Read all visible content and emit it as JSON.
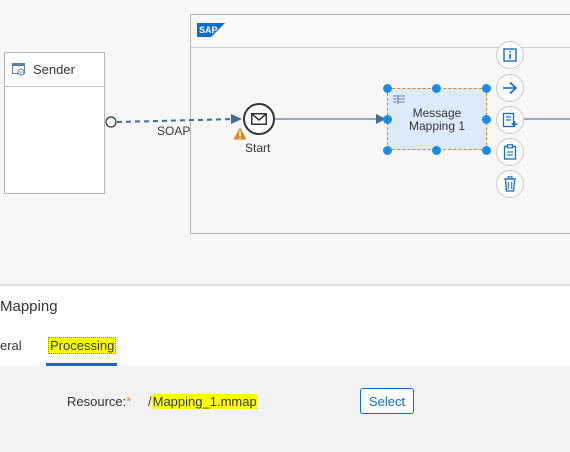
{
  "diagram": {
    "sender": {
      "label": "Sender"
    },
    "integration_process": {
      "logo": "SAP"
    },
    "connection": {
      "adapter_label": "SOAP"
    },
    "start_event": {
      "label": "Start",
      "icon": "envelope-icon",
      "warning_icon": "warning-icon"
    },
    "mapping_step": {
      "line1": "Message",
      "line2": "Mapping 1"
    },
    "context_buttons": [
      "info-icon",
      "arrow-right-icon",
      "add-step-icon",
      "clipboard-icon",
      "trash-icon"
    ]
  },
  "panel": {
    "title": "Mapping",
    "tabs": [
      {
        "label": "eral"
      },
      {
        "label": "Processing",
        "selected": true
      }
    ],
    "resource": {
      "label": "Resource:",
      "required_mark": "*",
      "value_prefix": "/",
      "value": "Mapping_1.mmap",
      "select_label": "Select"
    }
  },
  "colors": {
    "accent": "#0a6ed1",
    "highlight": "#ffff00",
    "selection": "#e6821e",
    "step_fill": "#dcebfa"
  }
}
